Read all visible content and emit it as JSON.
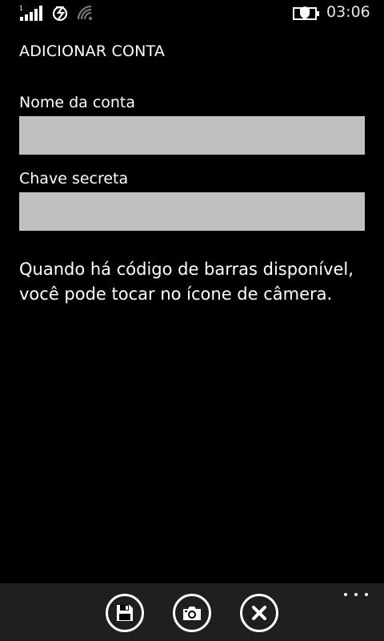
{
  "status_bar": {
    "signal_sim_label": "1",
    "time": "03:06",
    "icons": [
      "signal-strength-icon",
      "roaming-icon",
      "wifi-icon",
      "battery-saver-icon"
    ]
  },
  "page": {
    "title": "ADICIONAR CONTA"
  },
  "form": {
    "account_name_label": "Nome da conta",
    "account_name_value": "",
    "secret_key_label": "Chave secreta",
    "secret_key_value": ""
  },
  "hint": {
    "text": "Quando há código de barras disponível, você pode tocar no ícone de câmera."
  },
  "app_bar": {
    "buttons": [
      "save-icon",
      "camera-icon",
      "close-icon"
    ],
    "more_icon": "more-dots-icon",
    "background": "#1f1f1f"
  },
  "colors": {
    "background": "#000000",
    "input_background": "#c0c0c0",
    "text": "#ffffff"
  }
}
